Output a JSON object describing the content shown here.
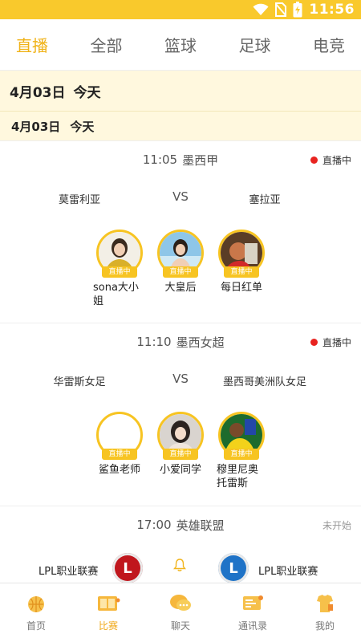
{
  "status_bar": {
    "time": "11:56"
  },
  "tabs": [
    {
      "label": "直播",
      "active": true
    },
    {
      "label": "全部"
    },
    {
      "label": "篮球"
    },
    {
      "label": "足球"
    },
    {
      "label": "电竞"
    }
  ],
  "date_header": {
    "date": "4月03日",
    "day": "今天"
  },
  "date_subheader": {
    "date": "4月03日",
    "day": "今天"
  },
  "matches": [
    {
      "time": "11:05",
      "league": "墨西甲",
      "status": "直播中",
      "home": "莫雷利亚",
      "vs": "VS",
      "away": "塞拉亚",
      "anchors": [
        {
          "name": "sona大小姐",
          "tag": "直播中"
        },
        {
          "name": "大皇后",
          "tag": "直播中"
        },
        {
          "name": "每日红单",
          "tag": "直播中"
        }
      ]
    },
    {
      "time": "11:10",
      "league": "墨西女超",
      "status": "直播中",
      "home": "华雷斯女足",
      "vs": "VS",
      "away": "墨西哥美洲队女足",
      "anchors": [
        {
          "name": "鲨鱼老师",
          "tag": "直播中"
        },
        {
          "name": "小爱同学",
          "tag": "直播中"
        },
        {
          "name": "穆里尼奥托雷斯",
          "tag": "直播中"
        }
      ]
    },
    {
      "time": "17:00",
      "league": "英雄联盟",
      "status": "未开始",
      "home": "LPL职业联赛",
      "away": "LPL职业联赛",
      "home_logo": "L",
      "away_logo": "L"
    }
  ],
  "bottom_nav": [
    {
      "label": "首页",
      "icon": "home-icon"
    },
    {
      "label": "比赛",
      "icon": "match-icon",
      "active": true
    },
    {
      "label": "聊天",
      "icon": "chat-icon"
    },
    {
      "label": "通讯录",
      "icon": "contacts-icon"
    },
    {
      "label": "我的",
      "icon": "profile-icon"
    }
  ],
  "colors": {
    "accent": "#f9c92c",
    "live_dot": "#e8231f",
    "active_tab": "#f0b217"
  }
}
